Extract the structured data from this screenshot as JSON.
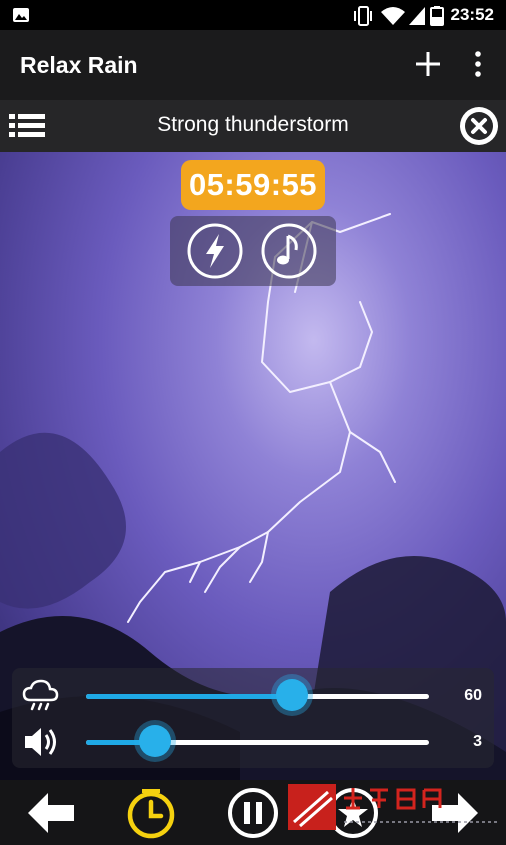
{
  "status_bar": {
    "time": "23:52"
  },
  "app_bar": {
    "title": "Relax Rain"
  },
  "track": {
    "name": "Strong thunderstorm"
  },
  "timer": {
    "display": "05:59:55"
  },
  "sliders": [
    {
      "icon": "rain-cloud-icon",
      "value": "60",
      "level": 0.6
    },
    {
      "icon": "volume-icon",
      "value": "3",
      "level": 0.2
    }
  ],
  "watermark": {
    "name": "牵芊精典",
    "url": "www.myqqjd.com"
  },
  "colors": {
    "timer": "#f3a61e",
    "slider_accent": "#28b0ea",
    "clock_icon": "#f5d10f"
  }
}
